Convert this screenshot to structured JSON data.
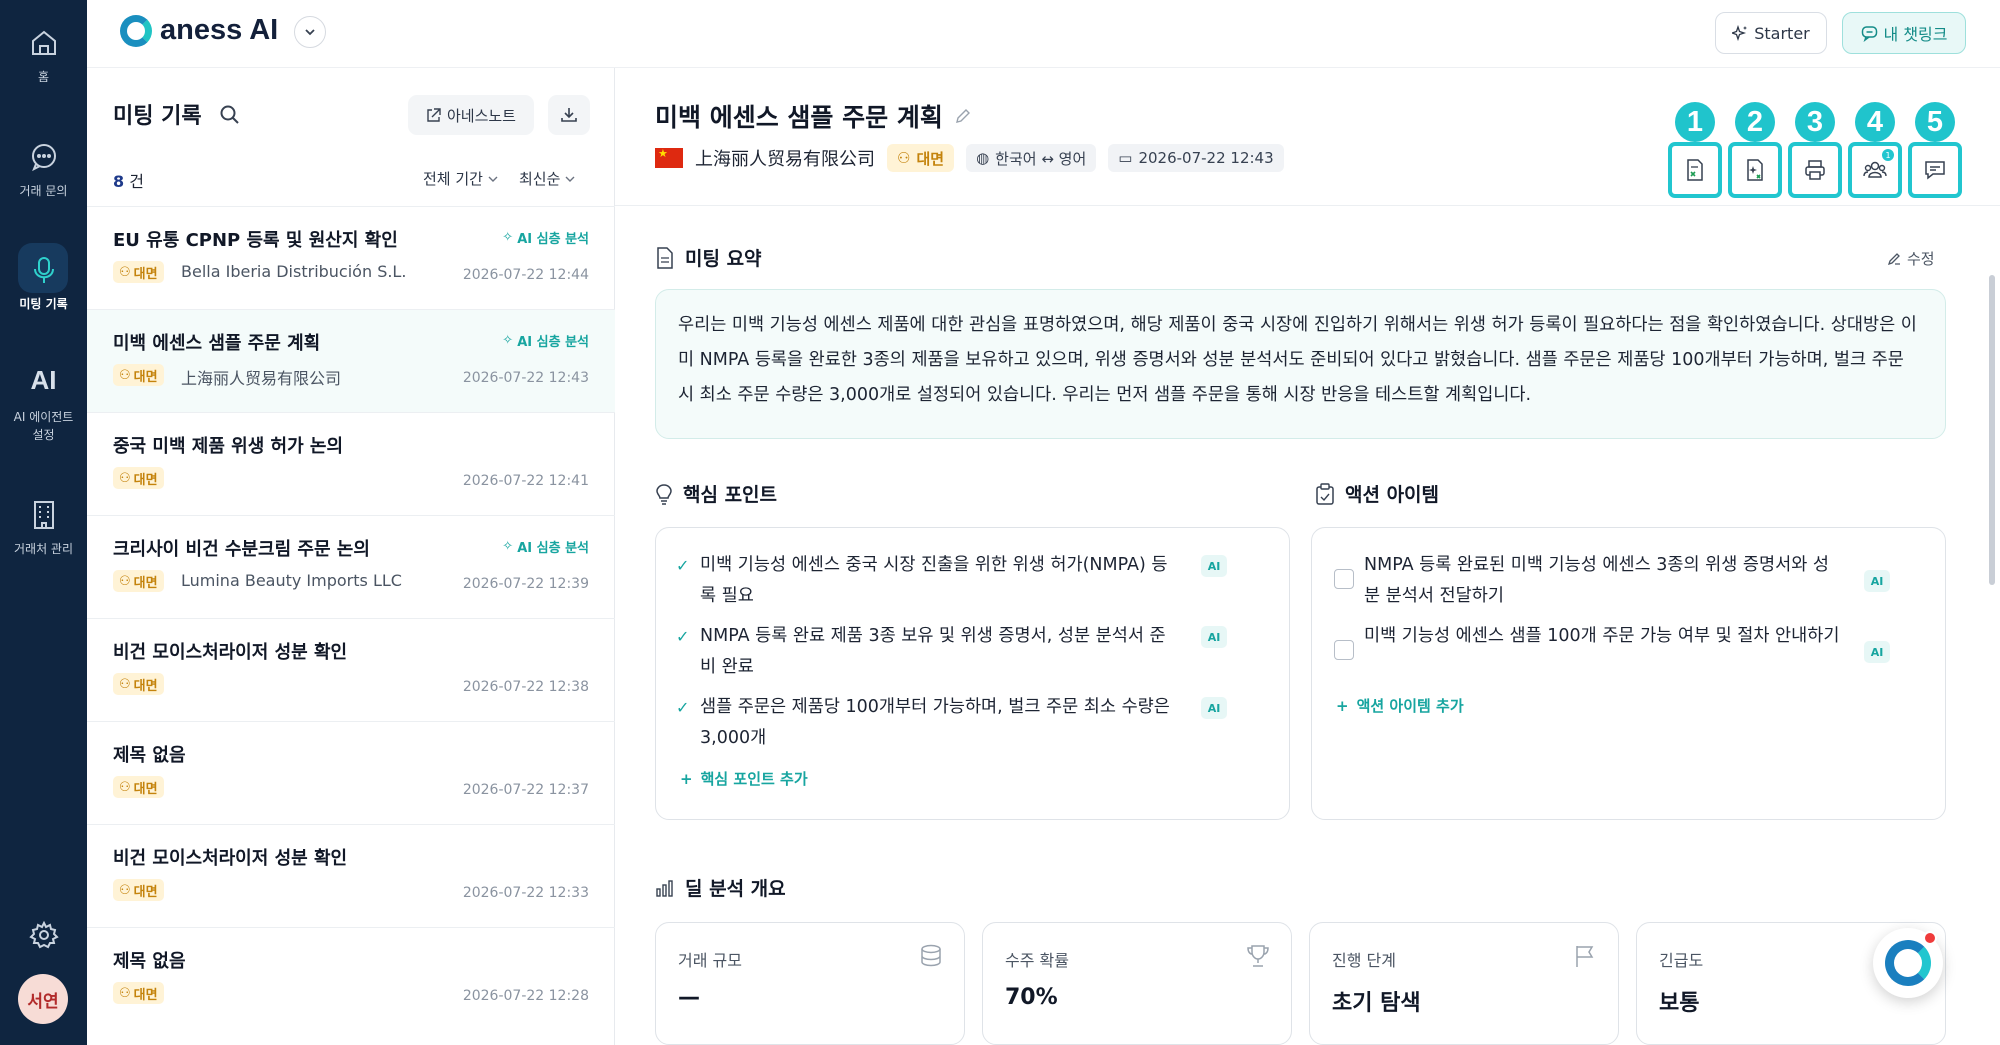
{
  "nav": {
    "home": "홈",
    "inquiry": "거래 문의",
    "meeting": "미팅 기록",
    "ai_mark": "AI",
    "ai_agent_l1": "AI 에이전트",
    "ai_agent_l2": "설정",
    "partners": "거래처 관리",
    "user": "서연"
  },
  "topbar": {
    "brand": "aness AI",
    "starter": "Starter",
    "chatlink": "내 챗링크"
  },
  "list": {
    "title": "미팅 기록",
    "note_button": "아네스노트",
    "count_num": "8",
    "count_unit": "건",
    "filter_period": "전체 기간",
    "filter_sort": "최신순",
    "items": [
      {
        "title": "EU 유통 CPNP 등록 및 원산지 확인",
        "ai": "AI 심층 분석",
        "tag": "대면",
        "company": "Bella Iberia Distribución S.L.",
        "date": "2026-07-22 12:44"
      },
      {
        "title": "미백 에센스 샘플 주문 계획",
        "ai": "AI 심층 분석",
        "tag": "대면",
        "company": "上海丽人贸易有限公司",
        "date": "2026-07-22 12:43"
      },
      {
        "title": "중국 미백 제품 위생 허가 논의",
        "ai": "",
        "tag": "대면",
        "company": "",
        "date": "2026-07-22 12:41"
      },
      {
        "title": "크리사이 비건 수분크림 주문 논의",
        "ai": "AI 심층 분석",
        "tag": "대면",
        "company": "Lumina Beauty Imports LLC",
        "date": "2026-07-22 12:39"
      },
      {
        "title": "비건 모이스처라이저 성분 확인",
        "ai": "",
        "tag": "대면",
        "company": "",
        "date": "2026-07-22 12:38"
      },
      {
        "title": "제목 없음",
        "ai": "",
        "tag": "대면",
        "company": "",
        "date": "2026-07-22 12:37"
      },
      {
        "title": "비건 모이스처라이저 성분 확인",
        "ai": "",
        "tag": "대면",
        "company": "",
        "date": "2026-07-22 12:33"
      },
      {
        "title": "제목 없음",
        "ai": "",
        "tag": "대면",
        "company": "",
        "date": "2026-07-22 12:28"
      }
    ]
  },
  "detail": {
    "title": "미백 에센스 샘플 주문 계획",
    "company": "上海丽人贸易有限公司",
    "tag": "대면",
    "language": "한국어 ↔ 영어",
    "datetime": "2026-07-22 12:43",
    "tool_numbers": [
      "1",
      "2",
      "3",
      "4",
      "5"
    ],
    "participants_badge": "1",
    "summary_heading": "미팅 요약",
    "edit": "수정",
    "summary_text": "우리는 미백 기능성 에센스 제품에 대한 관심을 표명하였으며, 해당 제품이 중국 시장에 진입하기 위해서는 위생 허가 등록이 필요하다는 점을 확인하였습니다. 상대방은 이미 NMPA 등록을 완료한 3종의 제품을 보유하고 있으며, 위생 증명서와 성분 분석서도 준비되어 있다고 밝혔습니다. 샘플 주문은 제품당 100개부터 가능하며, 벌크 주문 시 최소 주문 수량은 3,000개로 설정되어 있습니다. 우리는 먼저 샘플 주문을 통해 시장 반응을 테스트할 계획입니다.",
    "key_points_heading": "핵심 포인트",
    "key_points": [
      "미백 기능성 에센스 중국 시장 진출을 위한 위생 허가(NMPA) 등록 필요",
      "NMPA 등록 완료 제품 3종 보유 및 위생 증명서, 성분 분석서 준비 완료",
      "샘플 주문은 제품당 100개부터 가능하며, 벌크 주문 최소 수량은 3,000개"
    ],
    "ai_label": "AI",
    "add_key_point": "핵심 포인트 추가",
    "actions_heading": "액션 아이템",
    "actions": [
      "NMPA 등록 완료된 미백 기능성 에센스 3종의 위생 증명서와 성분 분석서 전달하기",
      "미백 기능성 에센스 샘플 100개 주문 가능 여부 및 절차 안내하기"
    ],
    "add_action": "액션 아이템 추가",
    "deal_heading": "딜 분석 개요",
    "stats": [
      {
        "label": "거래 규모",
        "value": "—"
      },
      {
        "label": "수주 확률",
        "value": "70%"
      },
      {
        "label": "진행 단계",
        "value": "초기 탐색"
      },
      {
        "label": "긴급도",
        "value": "보통"
      }
    ]
  },
  "colors": {
    "nav_bg": "#0f2540",
    "accent": "#17a5a0",
    "highlight": "#21c6cf",
    "tag_bg": "#fff3d6",
    "tag_fg": "#c4830c"
  }
}
